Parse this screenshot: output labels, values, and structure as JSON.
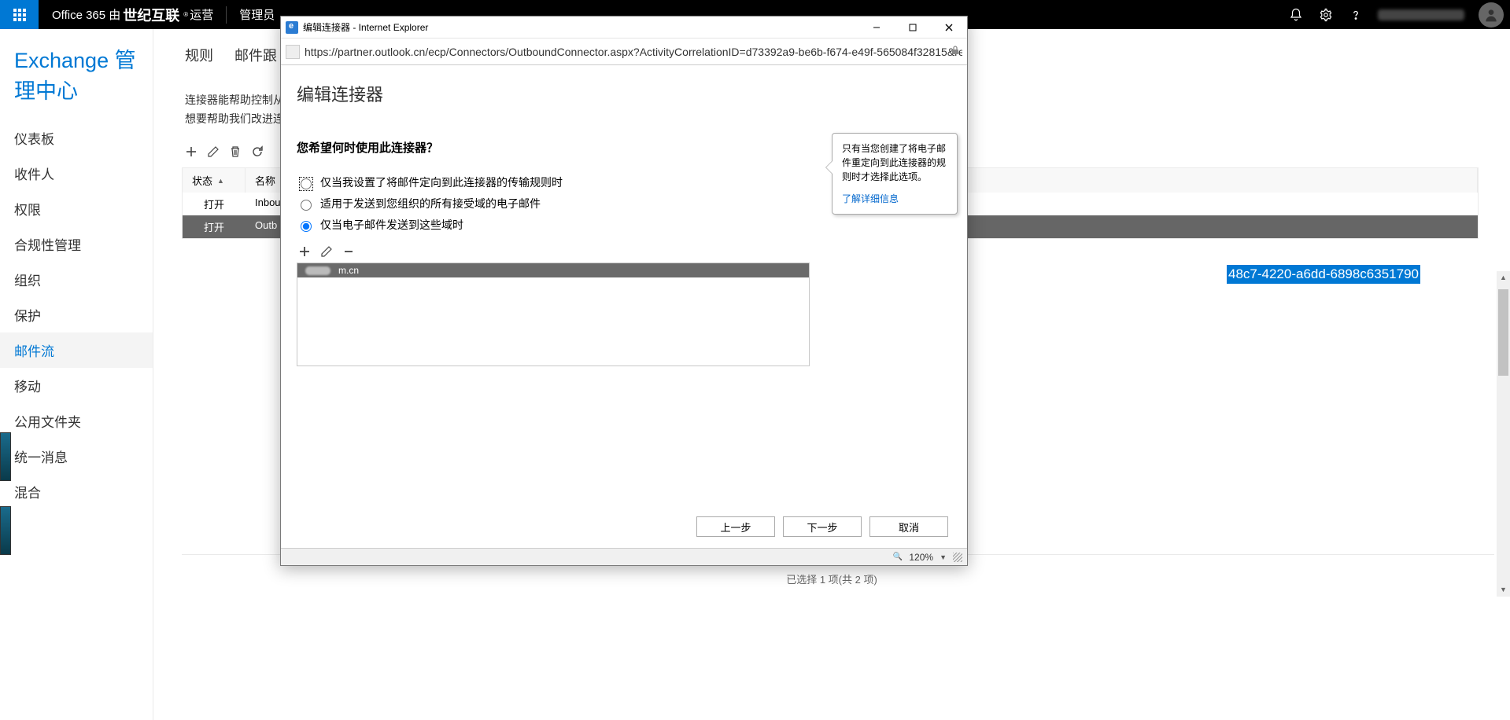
{
  "suite": {
    "brand_pre": "Office 365  由",
    "brand_big": "世纪互联",
    "brand_r": "®",
    "brand_post": "运营",
    "role": "管理员"
  },
  "exchange_heading": "Exchange 管理中心",
  "nav": {
    "items": [
      "仪表板",
      "收件人",
      "权限",
      "合规性管理",
      "组织",
      "保护",
      "邮件流",
      "移动",
      "公用文件夹",
      "统一消息",
      "混合"
    ],
    "active_index": 6
  },
  "tabs": {
    "rule": "规则",
    "trace": "邮件跟"
  },
  "desc": {
    "l1": "连接器能帮助控制从",
    "l2": "想要帮助我们改进连"
  },
  "th": {
    "status": "状态",
    "name": "名称"
  },
  "rows": [
    {
      "status": "打开",
      "name": "Inbou"
    },
    {
      "status": "打开",
      "name": "Outb"
    }
  ],
  "guid": "48c7-4220-a6dd-6898c6351790",
  "status_line": "已选择 1 项(共 2 项)",
  "popup": {
    "title": "编辑连接器 - Internet Explorer",
    "url": "https://partner.outlook.cn/ecp/Connectors/OutboundConnector.aspx?ActivityCorrelationID=d73392a9-be6b-f674-e49f-565084f32815&re",
    "heading": "编辑连接器",
    "question": "您希望何时使用此连接器？",
    "opt1": "仅当我设置了将邮件定向到此连接器的传输规则时",
    "opt2": "适用于发送到您组织的所有接受域的电子邮件",
    "opt3": "仅当电子邮件发送到这些域时",
    "domain_item": "m.cn",
    "callout_text": "只有当您创建了将电子邮件重定向到此连接器的规则时才选择此选项。",
    "callout_link": "了解详细信息",
    "back": "上一步",
    "next": "下一步",
    "cancel": "取消",
    "zoom": "120%"
  }
}
